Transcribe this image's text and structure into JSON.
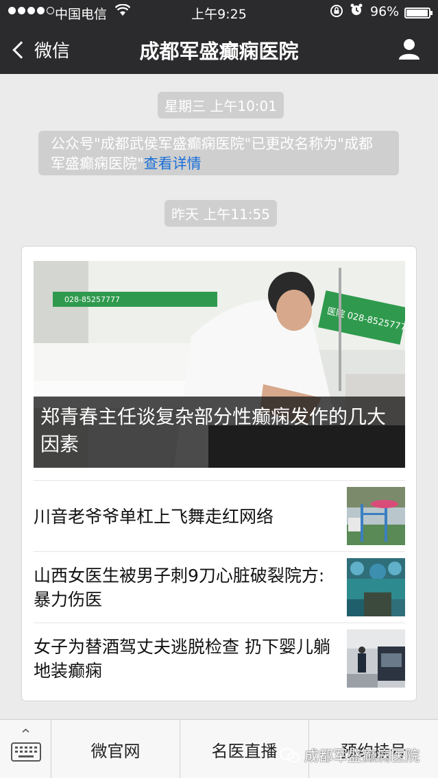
{
  "status_bar": {
    "carrier": "中国电信",
    "time": "上午9:25",
    "battery": "96%",
    "battery_level": 0.96
  },
  "nav": {
    "back_label": "微信",
    "title": "成都军盛癫痫医院"
  },
  "chat": {
    "time1": "星期三 上午10:01",
    "notice_text": "公众号\"成都武侯军盛癫痫医院\"已更改名称为\"成都军盛癫痫医院\"",
    "notice_link": "查看详情",
    "time2": "昨天 上午11:55",
    "card": {
      "hero_title": "郑青春主任谈复杂部分性癫痫发作的几大因素",
      "hero_banner_text": "028-85257777",
      "hero_banner_text2": "医院 028-8525777",
      "articles": [
        {
          "title": "川音老爷爷单杠上飞舞走红网络"
        },
        {
          "title": "山西女医生被男子刺9刀心脏破裂院方:暴力伤医"
        },
        {
          "title": "女子为替酒驾丈夫逃脱检查 扔下婴儿躺地装癫痫"
        }
      ]
    }
  },
  "menu": {
    "items": [
      "微官网",
      "名医直播",
      "预约挂号"
    ]
  },
  "watermark": "成都军盛癫痫医院",
  "colors": {
    "topbar": "#2b2b2d",
    "background": "#ebebeb",
    "link": "#1a6fd8"
  }
}
